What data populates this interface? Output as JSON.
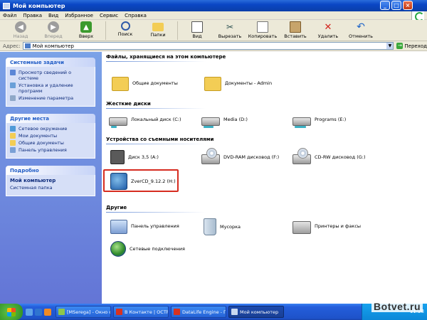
{
  "window": {
    "title": "Мой компьютер"
  },
  "menu": [
    "Файл",
    "Правка",
    "Вид",
    "Избранное",
    "Сервис",
    "Справка"
  ],
  "toolbar": {
    "back": "Назад",
    "forward": "Вперед",
    "up": "Вверх",
    "search": "Поиск",
    "folders": "Папки",
    "view": "Вид",
    "cut": "Вырезать",
    "copy": "Копировать",
    "paste": "Вставить",
    "delete": "Удалить",
    "undo": "Отменить"
  },
  "address": {
    "label": "Адрес:",
    "value": "Мой компьютер",
    "go": "Переход"
  },
  "sidebar": {
    "system_tasks": {
      "title": "Системные задачи",
      "items": [
        "Просмотр сведений о системе",
        "Установка и удаление программ",
        "Изменение параметра"
      ]
    },
    "other_places": {
      "title": "Другие места",
      "items": [
        "Сетевое окружение",
        "Мои документы",
        "Общие документы",
        "Панель управления"
      ]
    },
    "details": {
      "title": "Подробно",
      "name": "Мой компьютер",
      "type": "Системная папка"
    }
  },
  "groups": {
    "files": "Файлы, хранящиеся на этом компьютере",
    "hdd": "Жесткие диски",
    "removable": "Устройства со съемными носителями",
    "other": "Другие"
  },
  "files_items": [
    "Общие документы",
    "Документы - Admin"
  ],
  "hdd_items": [
    "Локальный диск (C:)",
    "Media (D:)",
    "Programs (E:)"
  ],
  "removable_items": [
    "Диск 3,5 (A:)",
    "DVD-RAM дисковод (F:)",
    "CD-RW дисковод (G:)",
    "ZverCD_9.12.2 (H:)"
  ],
  "other_items": [
    "Панель управления",
    "Мусорка",
    "Принтеры и факсы",
    "Сетевые подключения"
  ],
  "taskbar": {
    "tasks": [
      "[MSerega] - Окно со...",
      "В Контакте | ОСТРО...",
      "DataLife Engine - П...",
      "Мой компьютер"
    ],
    "clock": "11:28"
  },
  "watermark": "Botvet.ru",
  "colors": {
    "titlebar": "#0a46c4",
    "taskpane": "#7ba2e7",
    "highlight": "#d62c20"
  }
}
